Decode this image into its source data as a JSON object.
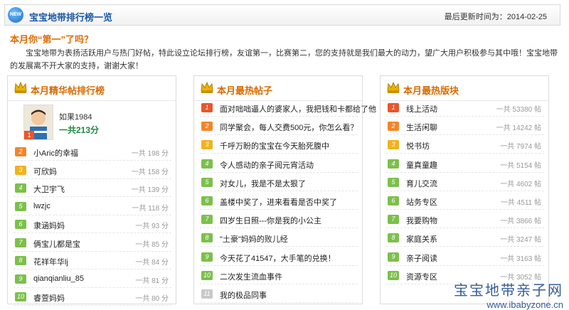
{
  "header": {
    "title": "宝宝地带排行榜一览",
    "new_badge": "NEW",
    "updated_label": "最后更新时间为：2014-02-25"
  },
  "headline": "本月你“第一”了吗？",
  "intro": "宝宝地带为表扬活跃用户与热门好帖，特此设立论坛排行榜，友谊第一，比赛第二，您的支持就是我们最大的动力，望广大用户积极参与其中哦！宝宝地带的发展离不开大家的支持，谢谢大家！",
  "panels": {
    "users": {
      "title": "本月精华帖排行榜",
      "featured": {
        "rank": "1",
        "name": "如果1984",
        "count": "一共213分"
      },
      "items": [
        {
          "rank": "2",
          "name": "小Aric的幸福",
          "count": "一共 198 分"
        },
        {
          "rank": "3",
          "name": "可欣妈",
          "count": "一共 158 分"
        },
        {
          "rank": "4",
          "name": "大卫宇飞",
          "count": "一共 139 分"
        },
        {
          "rank": "5",
          "name": "lwzjc",
          "count": "一共 118 分"
        },
        {
          "rank": "6",
          "name": "隶涵妈妈",
          "count": "一共 93 分"
        },
        {
          "rank": "7",
          "name": "俩宝儿都是宝",
          "count": "一共 85 分"
        },
        {
          "rank": "8",
          "name": "花祥年华lj",
          "count": "一共 84 分"
        },
        {
          "rank": "9",
          "name": "qianqianliu_85",
          "count": "一共 81 分"
        },
        {
          "rank": "10",
          "name": "睿萱妈妈",
          "count": "一共 80 分"
        }
      ]
    },
    "posts": {
      "title": "本月最热帖子",
      "items": [
        {
          "rank": "1",
          "name": "面对咄咄逼人的婆家人，我把钱和卡都给了他"
        },
        {
          "rank": "2",
          "name": "同学聚会，每人交费500元，你怎么看？"
        },
        {
          "rank": "3",
          "name": "千呼万盼的宝宝在今天胎死腹中"
        },
        {
          "rank": "4",
          "name": "令人感动的亲子阅元宵活动"
        },
        {
          "rank": "5",
          "name": "对女儿，我是不是太狠了"
        },
        {
          "rank": "6",
          "name": "盖楼中奖了，进来看看是否中奖了"
        },
        {
          "rank": "7",
          "name": "四岁生日照---你是我的小公主"
        },
        {
          "rank": "8",
          "name": "\"土豪\"妈妈的败儿经"
        },
        {
          "rank": "9",
          "name": "今天花了41547，大手笔的兑换！"
        },
        {
          "rank": "10",
          "name": "二次发生流血事件"
        },
        {
          "rank": "11",
          "name": "我的极品同事"
        }
      ]
    },
    "boards": {
      "title": "本月最热版块",
      "items": [
        {
          "rank": "1",
          "name": "线上活动",
          "count": "一共 53380 帖"
        },
        {
          "rank": "2",
          "name": "生活闲聊",
          "count": "一共 14242 帖"
        },
        {
          "rank": "3",
          "name": "悦书坊",
          "count": "一共 7974 帖"
        },
        {
          "rank": "4",
          "name": "童真童趣",
          "count": "一共 5154 帖"
        },
        {
          "rank": "5",
          "name": "育儿交流",
          "count": "一共 4602 帖"
        },
        {
          "rank": "6",
          "name": "站务专区",
          "count": "一共 4511 帖"
        },
        {
          "rank": "7",
          "name": "我要购物",
          "count": "一共 3866 帖"
        },
        {
          "rank": "8",
          "name": "家庭关系",
          "count": "一共 3247 帖"
        },
        {
          "rank": "9",
          "name": "亲子阅读",
          "count": "一共 3163 帖"
        },
        {
          "rank": "10",
          "name": "资源专区",
          "count": "一共 3052 帖"
        }
      ]
    }
  },
  "watermark": {
    "cn": "宝宝地带亲子网",
    "url": "www.ibabyzone.cn"
  },
  "colors": {
    "accent": "#e06b00",
    "title_blue": "#1a57a6",
    "green": "#7cc04b",
    "rank1": "#e8562c",
    "rank2": "#f3852a",
    "rank3": "#f3b21d"
  }
}
